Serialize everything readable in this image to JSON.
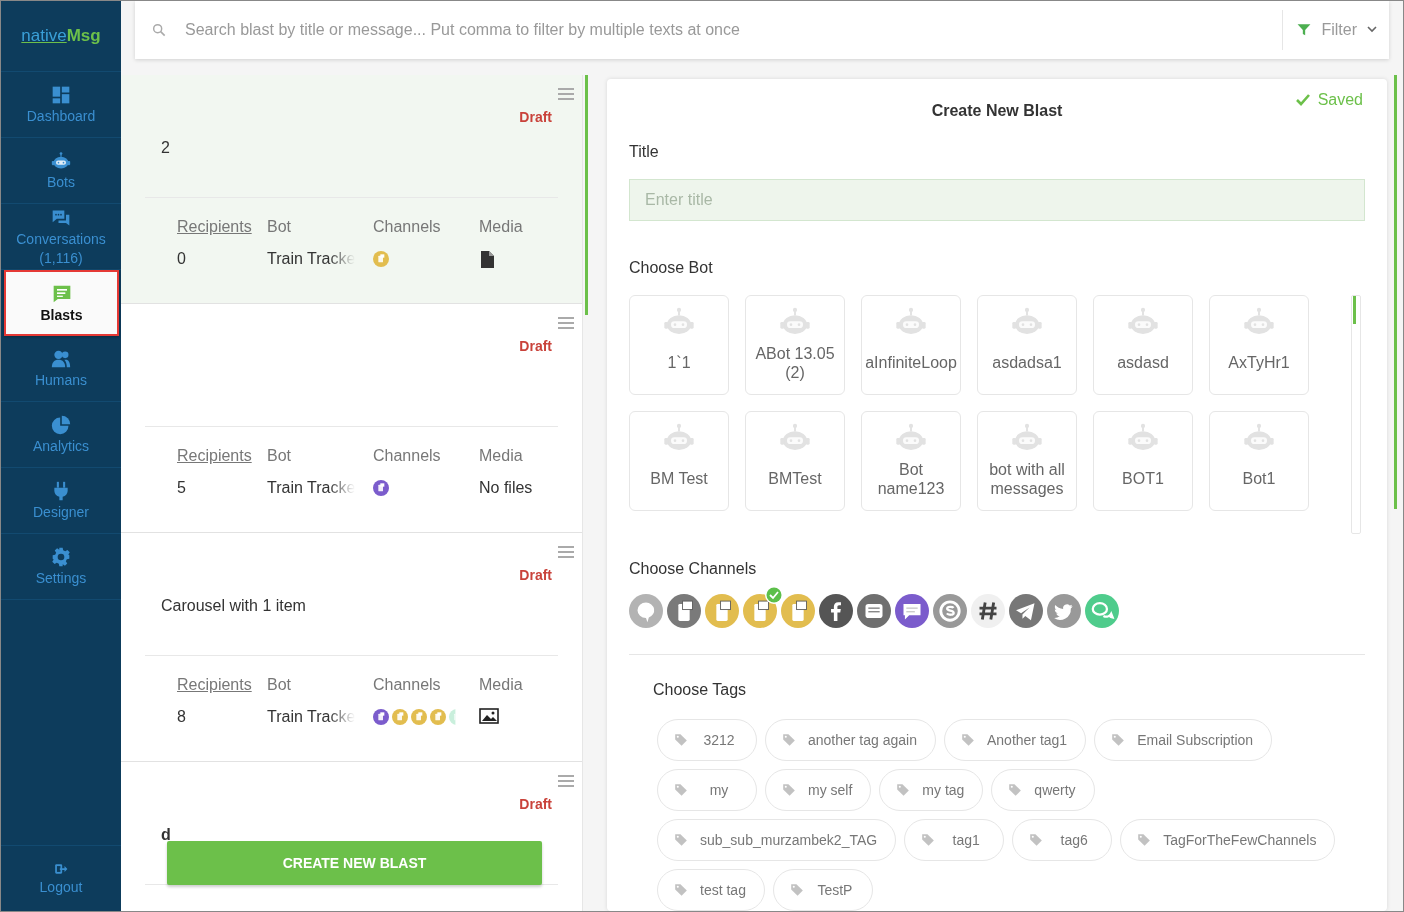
{
  "sidebar": {
    "logo": {
      "part_1": "native",
      "part_2": "Msg"
    },
    "items": [
      {
        "label": "Dashboard",
        "selected": false
      },
      {
        "label": "Bots",
        "selected": false
      },
      {
        "label": "Conversations",
        "count": "(1,116)",
        "selected": false
      },
      {
        "label": "Blasts",
        "selected": true
      },
      {
        "label": "Humans",
        "selected": false
      },
      {
        "label": "Analytics",
        "selected": false
      },
      {
        "label": "Designer",
        "selected": false
      },
      {
        "label": "Settings",
        "selected": false
      }
    ],
    "logout": {
      "label": "Logout"
    }
  },
  "search": {
    "placeholder": "Search blast by title or message... Put comma to filter by multiple texts at once",
    "filter_label": "Filter"
  },
  "blasts": [
    {
      "title": "2",
      "status": "Draft",
      "selected": true,
      "columns": [
        "Recipients",
        "Bot",
        "Channels",
        "Media"
      ],
      "recipients": "0",
      "bot": "Train Tracke",
      "channels": [
        {
          "color": "#e2bd4f"
        }
      ],
      "media": {
        "kind": "file"
      }
    },
    {
      "status": "Draft",
      "selected": false,
      "columns": [
        "Recipients",
        "Bot",
        "Channels",
        "Media"
      ],
      "recipients": "5",
      "bot": "Train Tracke",
      "channels": [
        {
          "color": "#7b5ccc"
        }
      ],
      "media": {
        "kind": "none",
        "text": "No files"
      }
    },
    {
      "title": "Carousel with 1 item",
      "status": "Draft",
      "selected": false,
      "columns": [
        "Recipients",
        "Bot",
        "Channels",
        "Media"
      ],
      "recipients": "8",
      "bot": "Train Tracke",
      "channels": [
        {
          "color": "#7b5ccc"
        },
        {
          "color": "#e2bd4f"
        },
        {
          "color": "#e2bd4f"
        },
        {
          "color": "#e2bd4f"
        },
        {
          "color": "#c9efdc"
        }
      ],
      "media": {
        "kind": "image"
      }
    },
    {
      "title": "d",
      "bold": true,
      "status": "Draft",
      "selected": false
    }
  ],
  "create_button": "CREATE NEW BLAST",
  "form": {
    "heading": "Create New Blast",
    "saved": "Saved",
    "title_label": "Title",
    "title_placeholder": "Enter title",
    "bot_label": "Choose Bot",
    "bots": [
      "1`1",
      "ABot 13.05 (2)",
      "aInfiniteLoop",
      "asdadsa1",
      "asdasd",
      "AxTyHr1",
      "BM Test",
      "BMTest",
      "Bot name123",
      "bot with all messages",
      "BOT1",
      "Bot1"
    ],
    "channels_label": "Choose Channels",
    "channels": [
      {
        "kind": "bubble",
        "color": "#b3b3b3",
        "selected": false
      },
      {
        "kind": "phone",
        "color": "#7a7a7a",
        "selected": false
      },
      {
        "kind": "phone",
        "color": "#e2bd4f",
        "selected": false
      },
      {
        "kind": "phone",
        "color": "#e2bd4f",
        "selected": true
      },
      {
        "kind": "phone",
        "color": "#e2bd4f",
        "selected": false
      },
      {
        "kind": "facebook",
        "color": "#555555",
        "selected": false
      },
      {
        "kind": "sms",
        "color": "#6f6f6f",
        "selected": false
      },
      {
        "kind": "chat",
        "color": "#7b5ccc",
        "selected": false
      },
      {
        "kind": "skype",
        "color": "#999999",
        "selected": false
      },
      {
        "kind": "slack",
        "color": "#f0f0f0",
        "selected": false
      },
      {
        "kind": "telegram",
        "color": "#777777",
        "selected": false
      },
      {
        "kind": "twitter",
        "color": "#999999",
        "selected": false
      },
      {
        "kind": "chats",
        "color": "#4fcc8c",
        "selected": false
      }
    ],
    "tags_label": "Choose Tags",
    "tags": [
      "3212",
      "another tag again",
      "Another tag1",
      "Email Subscription",
      "my",
      "my self",
      "my tag",
      "qwerty",
      "sub_sub_murzambek2_TAG",
      "tag1",
      "tag6",
      "TagForTheFewChannels",
      "test tag",
      "TestP"
    ]
  }
}
